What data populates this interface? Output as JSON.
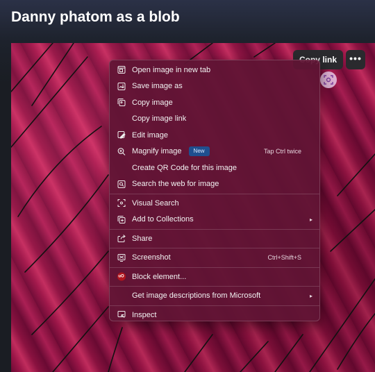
{
  "page": {
    "title": "Danny phatom as a blob"
  },
  "image_toolbar": {
    "copy_link_label": "Copy link",
    "more_label": "•••"
  },
  "context_menu": {
    "items": [
      {
        "label": "Open image in new tab",
        "icon": "open-new-tab-icon"
      },
      {
        "label": "Save image as",
        "icon": "save-image-icon"
      },
      {
        "label": "Copy image",
        "icon": "copy-image-icon"
      },
      {
        "label": "Copy image link",
        "icon": ""
      },
      {
        "label": "Edit image",
        "icon": "edit-image-icon"
      },
      {
        "label": "Magnify image",
        "icon": "magnify-icon",
        "badge": "New",
        "shortcut": "Tap Ctrl twice"
      },
      {
        "label": "Create QR Code for this image",
        "icon": ""
      },
      {
        "label": "Search the web for image",
        "icon": "search-web-icon"
      },
      {
        "label": "Visual Search",
        "icon": "visual-search-icon"
      },
      {
        "label": "Add to Collections",
        "icon": "collections-icon",
        "submenu": true
      },
      {
        "label": "Share",
        "icon": "share-icon"
      },
      {
        "label": "Screenshot",
        "icon": "screenshot-icon",
        "shortcut": "Ctrl+Shift+S"
      },
      {
        "label": "Block element...",
        "icon": "ublock-icon",
        "icon_text": "uO"
      },
      {
        "label": "Get image descriptions from Microsoft",
        "icon": "",
        "submenu": true
      },
      {
        "label": "Inspect",
        "icon": "inspect-icon"
      }
    ],
    "submenu_arrow": "▸"
  },
  "colors": {
    "menu_bg": "#60143a",
    "image_primary": "#9c1648",
    "new_badge": "#1f4f8f",
    "ublock": "#b0151d"
  }
}
